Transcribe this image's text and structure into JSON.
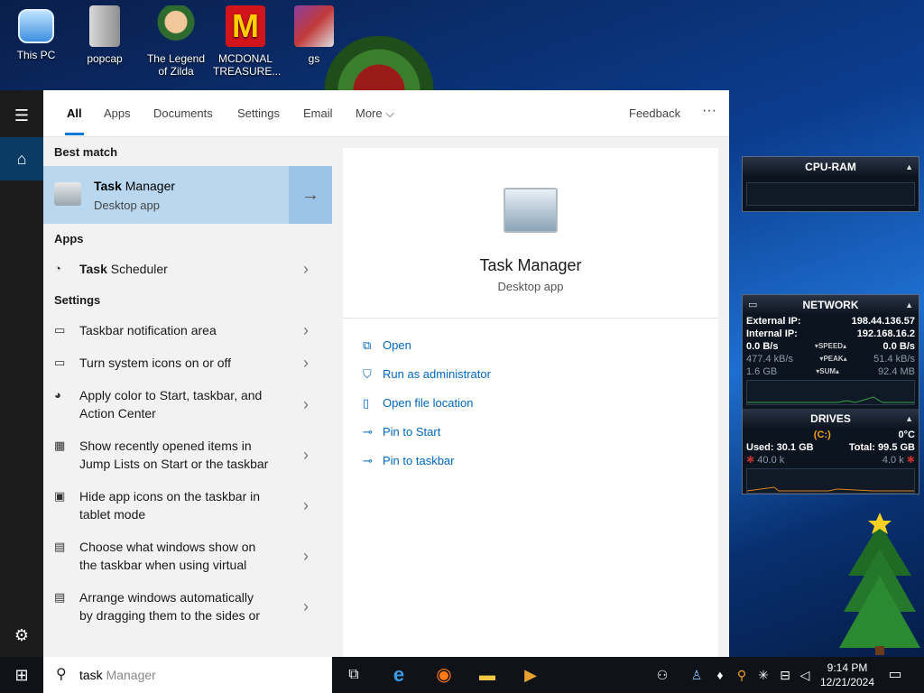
{
  "desktop_icons": [
    {
      "label": "This PC"
    },
    {
      "label": "popcap"
    },
    {
      "label": "The Legend of Zilda"
    },
    {
      "label": "MCDONAL TREASURE..."
    },
    {
      "label": "gs"
    }
  ],
  "gadgets": {
    "cpu_ram": {
      "title": "CPU-RAM"
    },
    "network": {
      "title": "NETWORK",
      "external_ip_label": "External IP:",
      "external_ip": "198.44.136.57",
      "internal_ip_label": "Internal IP:",
      "internal_ip": "192.168.16.2",
      "speed_left": "0.0 B/s",
      "speed_label": "SPEED",
      "speed_right": "0.0 B/s",
      "peak_left": "477.4 kB/s",
      "peak_label": "PEAK",
      "peak_right": "51.4 kB/s",
      "sum_left": "1.6 GB",
      "sum_label": "SUM",
      "sum_right": "92.4 MB"
    },
    "drives": {
      "title": "DRIVES",
      "drive_letter": "(C:)",
      "temp": "0°C",
      "used": "Used: 30.1 GB",
      "total": "Total: 99.5 GB",
      "read": "40.0 k",
      "write": "4.0 k"
    }
  },
  "tabs": [
    "All",
    "Apps",
    "Documents",
    "Settings",
    "Email",
    "More"
  ],
  "feedback": "Feedback",
  "more_dots": "···",
  "sections": {
    "best_match": "Best match",
    "apps": "Apps",
    "settings": "Settings"
  },
  "best_match": {
    "title_bold": "Task",
    "title_rest": " Manager",
    "subtitle": "Desktop app"
  },
  "apps": [
    {
      "bold": "Task",
      "rest": " Scheduler"
    }
  ],
  "settings": [
    {
      "line1": "Taskbar notification area",
      "line2": ""
    },
    {
      "line1": "Turn system icons on or off",
      "line2": ""
    },
    {
      "line1": "Apply color to Start, taskbar, and",
      "line2": "Action Center"
    },
    {
      "line1": "Show recently opened items in",
      "line2": "Jump Lists on Start or the taskbar"
    },
    {
      "line1": "Hide app icons on the taskbar in",
      "line2": "tablet mode"
    },
    {
      "line1": "Choose what windows show on",
      "line2": "the taskbar when using virtual"
    },
    {
      "line1": "Arrange windows automatically",
      "line2": "by dragging them to the sides or"
    }
  ],
  "preview": {
    "title": "Task Manager",
    "subtitle": "Desktop app",
    "actions": [
      "Open",
      "Run as administrator",
      "Open file location",
      "Pin to Start",
      "Pin to taskbar"
    ]
  },
  "search": {
    "typed": "task",
    "suggestion": " Manager"
  },
  "clock": {
    "time": "9:14 PM",
    "date": "12/21/2024"
  }
}
